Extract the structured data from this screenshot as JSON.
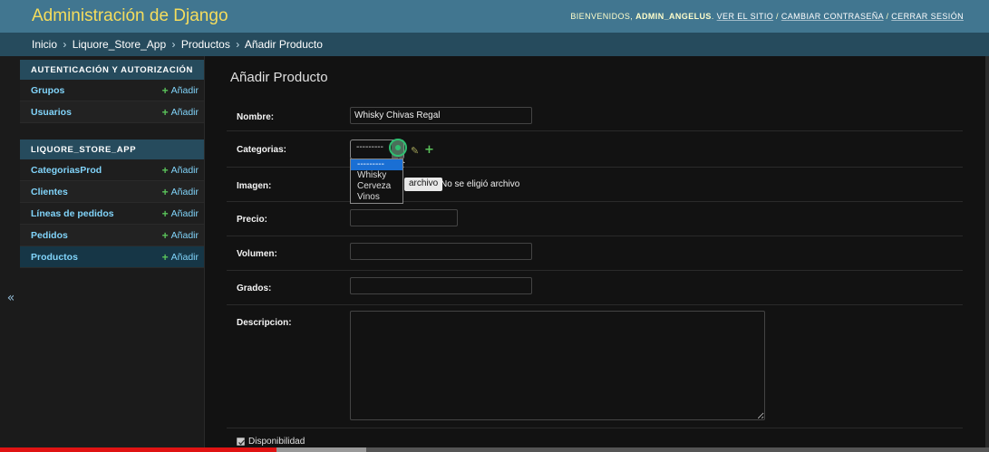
{
  "header": {
    "site_title": "Administración de Django",
    "welcome": "Bienvenidos,",
    "username": "ADMIN_ANGELUS",
    "view_site": "Ver el sitio",
    "change_password": "Cambiar contraseña",
    "logout": "Cerrar sesión",
    "sep": "/"
  },
  "breadcrumbs": {
    "items": [
      "Inicio",
      "Liquore_Store_App",
      "Productos",
      "Añadir Producto"
    ],
    "sep": "›"
  },
  "sidebar": {
    "collapse_toggle": "«",
    "modules": [
      {
        "caption": "Autenticación y autorización",
        "models": [
          {
            "label": "Grupos",
            "add": "Añadir"
          },
          {
            "label": "Usuarios",
            "add": "Añadir"
          }
        ]
      },
      {
        "caption": "Liquore_Store_App",
        "models": [
          {
            "label": "CategoriasProd",
            "add": "Añadir"
          },
          {
            "label": "Clientes",
            "add": "Añadir"
          },
          {
            "label": "Líneas de pedidos",
            "add": "Añadir"
          },
          {
            "label": "Pedidos",
            "add": "Añadir"
          },
          {
            "label": "Productos",
            "add": "Añadir"
          }
        ]
      }
    ]
  },
  "form": {
    "title": "Añadir Producto",
    "fields": {
      "nombre": {
        "label": "Nombre:",
        "value": "Whisky Chivas Regal"
      },
      "categorias": {
        "label": "Categorias:",
        "selected": "---------",
        "options": [
          "---------",
          "Whisky",
          "Cerveza",
          "Vinos"
        ]
      },
      "imagen": {
        "label": "Imagen:",
        "button": "archivo",
        "status": "No se eligió archivo"
      },
      "precio": {
        "label": "Precio:",
        "value": ""
      },
      "volumen": {
        "label": "Volumen:",
        "value": ""
      },
      "grados": {
        "label": "Grados:",
        "value": ""
      },
      "descripcion": {
        "label": "Descripcion:",
        "value": ""
      },
      "disponibilidad": {
        "label": "Disponibilidad",
        "checked": true
      }
    }
  },
  "colors": {
    "header_bg": "#417690",
    "breadcrumbs_bg": "#264b5d",
    "accent_link": "#81d4fa",
    "add_green": "#5ac35a",
    "dropdown_selected": "#1a6fd4"
  },
  "video_progress": {
    "played_fraction": 0.28,
    "buffered_fraction": 0.37
  }
}
